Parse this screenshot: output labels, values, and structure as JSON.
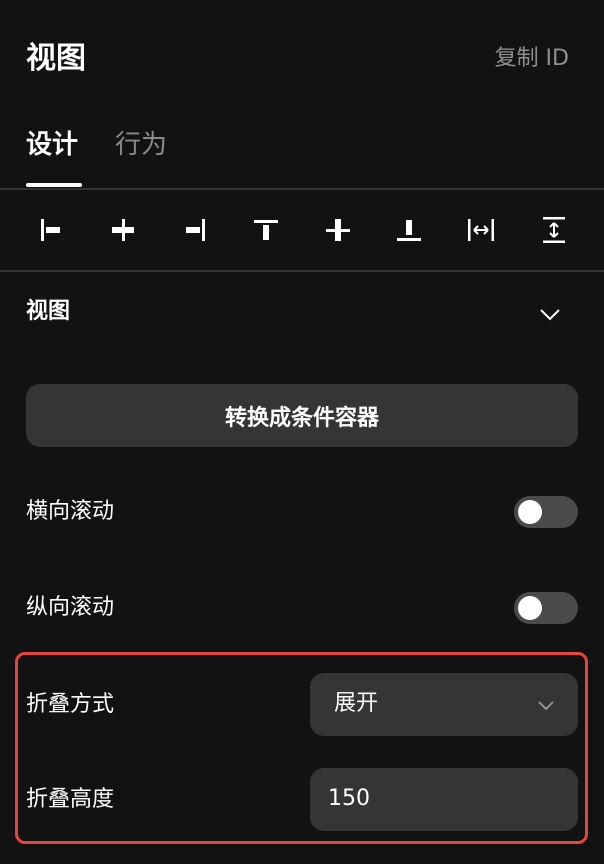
{
  "header": {
    "title": "视图",
    "copy_id_label": "复制 ID"
  },
  "tabs": [
    {
      "label": "设计",
      "active": true
    },
    {
      "label": "行为",
      "active": false
    }
  ],
  "alignment_tools": [
    {
      "icon": "align-left-icon"
    },
    {
      "icon": "align-horizontal-center-icon"
    },
    {
      "icon": "align-right-icon"
    },
    {
      "icon": "align-top-icon"
    },
    {
      "icon": "align-vertical-center-icon"
    },
    {
      "icon": "align-bottom-icon"
    },
    {
      "icon": "distribute-horizontal-icon"
    },
    {
      "icon": "distribute-vertical-icon"
    }
  ],
  "section": {
    "title": "视图",
    "collapse_icon": "chevron-down-icon",
    "convert_button_label": "转换成条件容器",
    "horizontal_scroll": {
      "label": "横向滚动",
      "enabled": false
    },
    "vertical_scroll": {
      "label": "纵向滚动",
      "enabled": false
    },
    "fold_mode": {
      "label": "折叠方式",
      "value": "展开"
    },
    "fold_height": {
      "label": "折叠高度",
      "value": "150"
    }
  },
  "colors": {
    "background": "#121212",
    "panel_control": "#353535",
    "toggle_off": "#4a4a4a",
    "highlight": "#e5463a",
    "muted_text": "#8f8f8f"
  }
}
